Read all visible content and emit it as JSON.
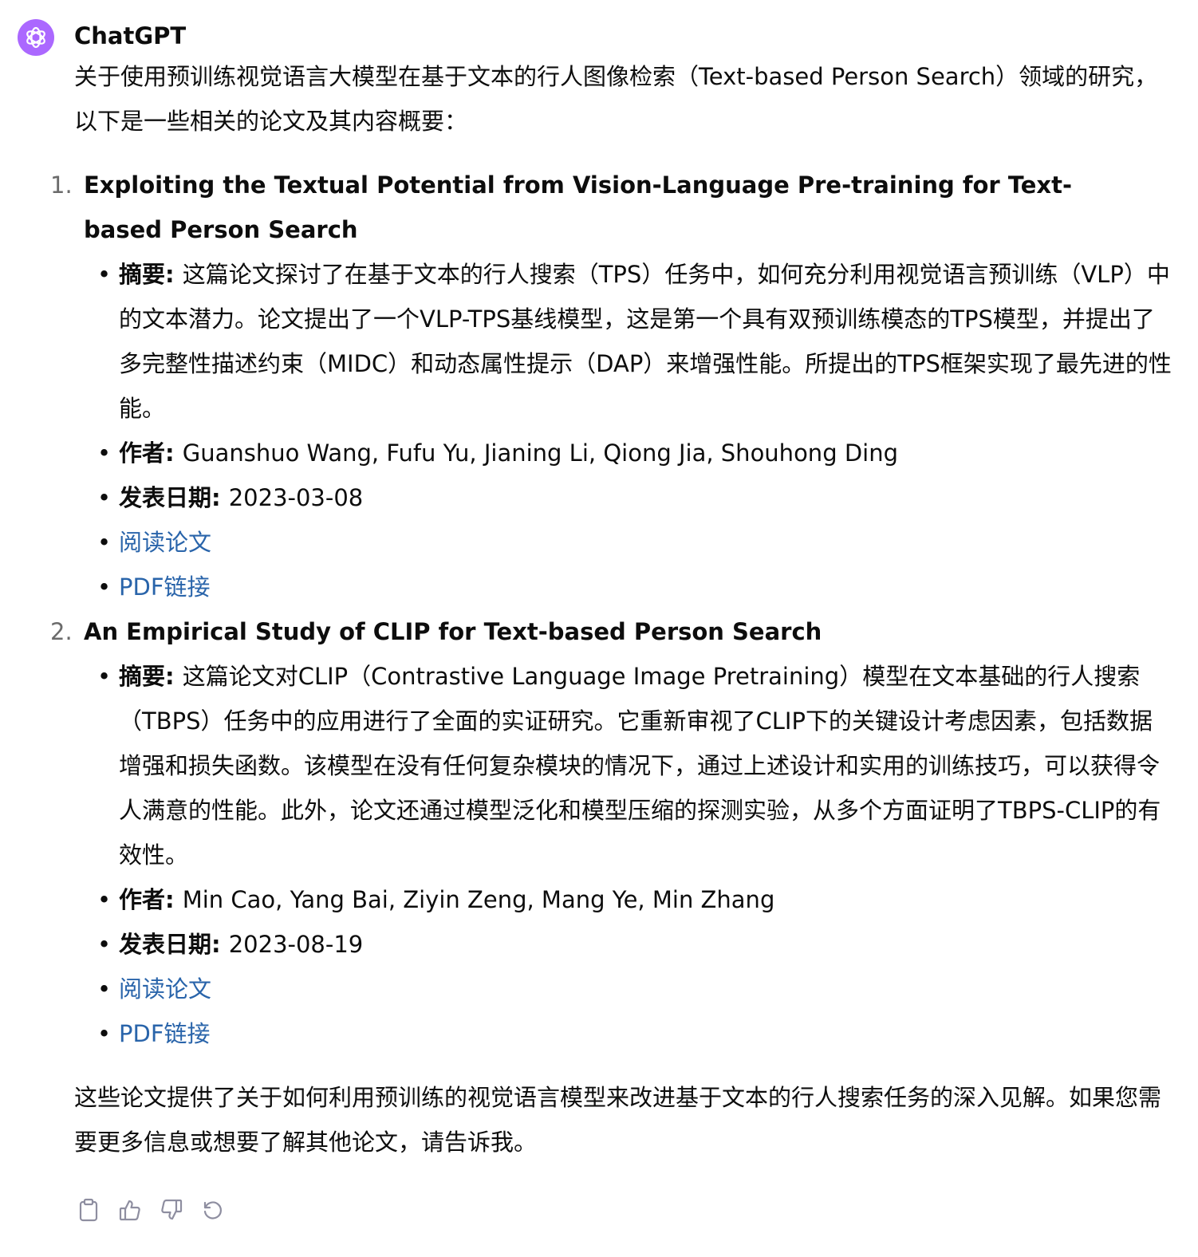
{
  "message": {
    "sender": "ChatGPT",
    "avatar_icon": "openai-logo-icon",
    "avatar_color": "#ab68ff",
    "intro": "关于使用预训练视觉语言大模型在基于文本的行人图像检索（Text-based Person Search）领域的研究，以下是一些相关的论文及其内容概要：",
    "papers": [
      {
        "number": "1.",
        "title": "Exploiting the Textual Potential from Vision-Language Pre-training for Text-based Person Search",
        "abstract_label": "摘要",
        "abstract": "这篇论文探讨了在基于文本的行人搜索（TPS）任务中，如何充分利用视觉语言预训练（VLP）中的文本潜力。论文提出了一个VLP-TPS基线模型，这是第一个具有双预训练模态的TPS模型，并提出了多完整性描述约束（MIDC）和动态属性提示（DAP）来增强性能。所提出的TPS框架实现了最先进的性能。",
        "authors_label": "作者",
        "authors": "Guanshuo Wang, Fufu Yu, Jianing Li, Qiong Jia, Shouhong Ding",
        "date_label": "发表日期",
        "date": "2023-03-08",
        "read_link": "阅读论文",
        "pdf_link": "PDF链接"
      },
      {
        "number": "2.",
        "title": "An Empirical Study of CLIP for Text-based Person Search",
        "abstract_label": "摘要",
        "abstract": "这篇论文对CLIP（Contrastive Language Image Pretraining）模型在文本基础的行人搜索（TBPS）任务中的应用进行了全面的实证研究。它重新审视了CLIP下的关键设计考虑因素，包括数据增强和损失函数。该模型在没有任何复杂模块的情况下，通过上述设计和实用的训练技巧，可以获得令人满意的性能。此外，论文还通过模型泛化和模型压缩的探测实验，从多个方面证明了TBPS-CLIP的有效性。",
        "authors_label": "作者",
        "authors": "Min Cao, Yang Bai, Ziyin Zeng, Mang Ye, Min Zhang",
        "date_label": "发表日期",
        "date": "2023-08-19",
        "read_link": "阅读论文",
        "pdf_link": "PDF链接"
      }
    ],
    "outro": "这些论文提供了关于如何利用预训练的视觉语言模型来改进基于文本的行人搜索任务的深入见解。如果您需要更多信息或想要了解其他论文，请告诉我。",
    "link_color": "#2964aa",
    "actions": [
      {
        "icon": "clipboard-icon"
      },
      {
        "icon": "thumbs-up-icon"
      },
      {
        "icon": "thumbs-down-icon"
      },
      {
        "icon": "regenerate-icon"
      }
    ]
  }
}
